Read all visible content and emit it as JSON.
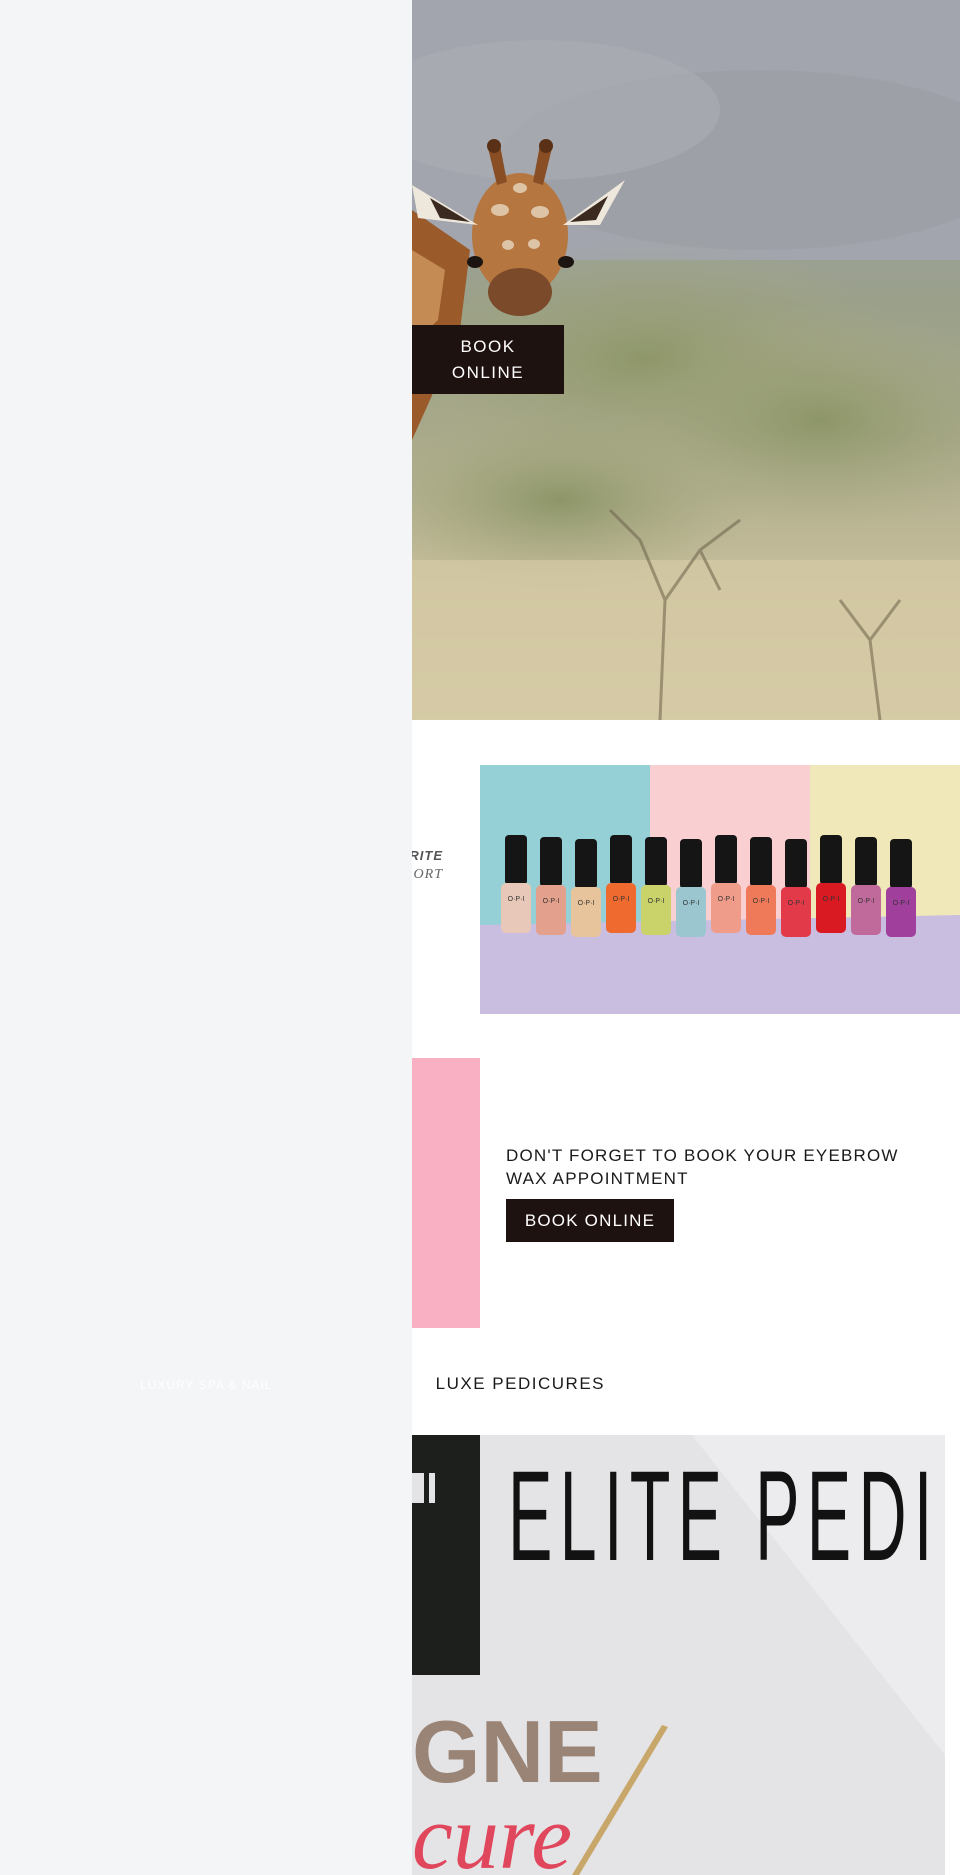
{
  "hero": {
    "book_button": "BOOK ONLINE",
    "image_alt": "giraffe-photo"
  },
  "promo": {
    "line1": "ORITE",
    "line2": "ORT",
    "image_alt": "opi-nail-polish-bottles",
    "bottle_brand": "O·P·I"
  },
  "eyebrow": {
    "text": "DON'T FORGET TO BOOK YOUR EYEBROW WAX APPOINTMENT",
    "button": "BOOK ONLINE",
    "accent": "#f9b0c3"
  },
  "pedicure": {
    "heading": "LUXE PEDICURES",
    "banner_title": "ELITE PEDI",
    "banner_gne": "GNE",
    "banner_cure": "cure"
  },
  "drawer": {
    "faint_text": "LUXURY SPA & NAIL"
  },
  "colors": {
    "dark_button": "#1e1210",
    "drawer_bg": "#f4f5f7",
    "pink": "#f9b0c3"
  }
}
